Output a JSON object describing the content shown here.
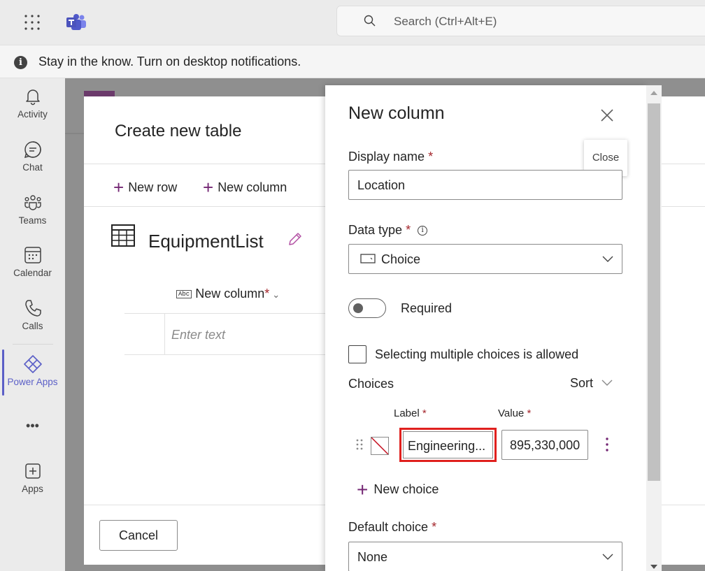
{
  "topbar": {
    "search_placeholder": "Search (Ctrl+Alt+E)"
  },
  "notification": {
    "icon": "info-icon",
    "text": "Stay in the know. Turn on desktop notifications."
  },
  "rail": {
    "items": [
      {
        "label": "Activity",
        "icon": "bell-icon"
      },
      {
        "label": "Chat",
        "icon": "chat-icon"
      },
      {
        "label": "Teams",
        "icon": "teams-icon"
      },
      {
        "label": "Calendar",
        "icon": "calendar-icon"
      },
      {
        "label": "Calls",
        "icon": "phone-icon"
      },
      {
        "label": "Power Apps",
        "icon": "power-apps-icon",
        "active": true
      },
      {
        "label": "Apps",
        "icon": "add-apps-icon"
      }
    ],
    "more": "•••",
    "accent": "#5b5fc7"
  },
  "dialog": {
    "title": "Create new table",
    "toolbar": {
      "new_row": "New row",
      "new_column": "New column"
    },
    "table_name": "EquipmentList",
    "column_header": "New column",
    "column_badge": "Abc",
    "required_star": "*",
    "cell_placeholder": "Enter text",
    "cancel_label": "Cancel"
  },
  "panel": {
    "title": "New column",
    "close_tooltip": "Close",
    "display_name": {
      "label": "Display name",
      "required": "*",
      "value": "Location"
    },
    "data_type": {
      "label": "Data type",
      "required": "*",
      "value": "Choice"
    },
    "required_toggle": {
      "label": "Required",
      "on": false
    },
    "multiple_choices": {
      "label": "Selecting multiple choices is allowed",
      "checked": false
    },
    "choices": {
      "label": "Choices",
      "sort_label": "Sort",
      "label_header": "Label",
      "value_header": "Value",
      "required": "*",
      "items": [
        {
          "label": "Engineering...",
          "value": "895,330,000"
        }
      ],
      "new_choice_label": "New choice"
    },
    "default_choice": {
      "label": "Default choice",
      "required": "*",
      "value": "None"
    },
    "accent": "#742774",
    "highlight_color": "#e0201e"
  }
}
